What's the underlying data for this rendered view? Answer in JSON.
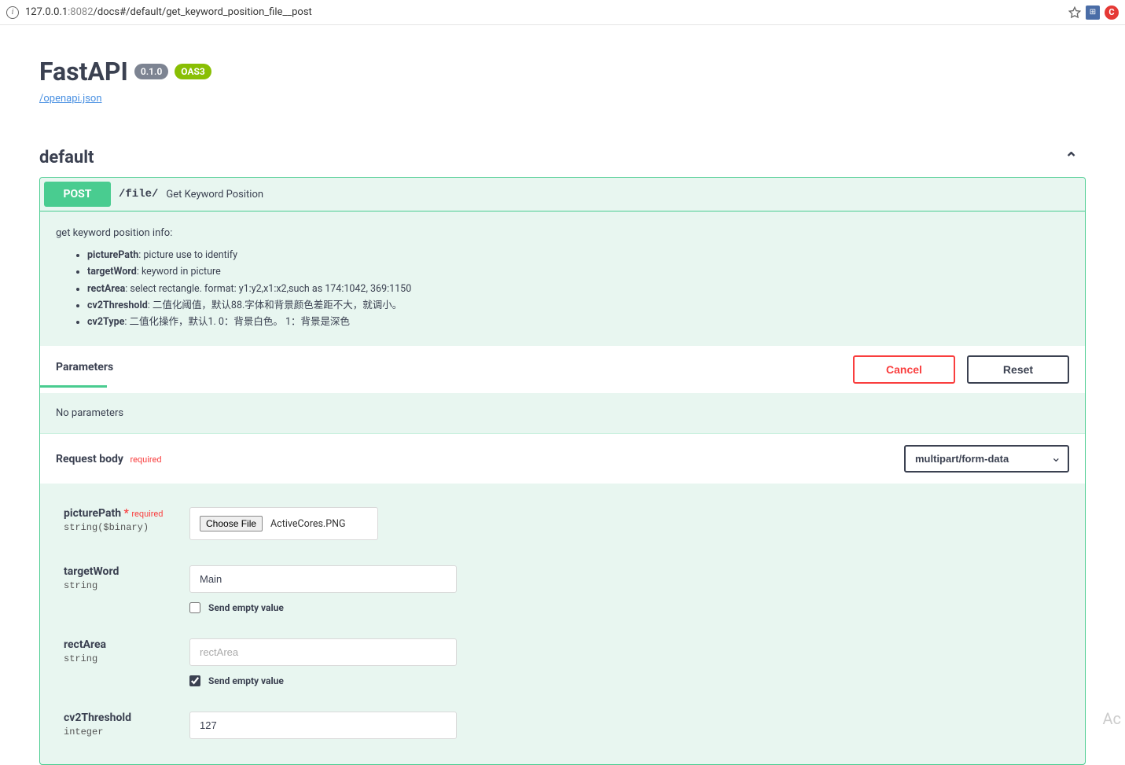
{
  "browser": {
    "url_host": "127.0.0.1",
    "url_port": ":8082",
    "url_path": "/docs#/default/get_keyword_position_file__post"
  },
  "header": {
    "title": "FastAPI",
    "version": "0.1.0",
    "oas": "OAS3",
    "openapi_link": "/openapi.json"
  },
  "section": {
    "name": "default"
  },
  "operation": {
    "method": "POST",
    "path": "/file/",
    "summary": "Get Keyword Position",
    "description": "get keyword position info:",
    "desc_items": [
      {
        "name": "picturePath",
        "text": ": picture use to identify"
      },
      {
        "name": "targetWord",
        "text": ": keyword in picture"
      },
      {
        "name": "rectArea",
        "text": ": select rectangle. format: y1:y2,x1:x2,such as 174:1042, 369:1150"
      },
      {
        "name": "cv2Threshold",
        "text": ": 二值化阈值，默认88.字体和背景颜色差距不大，就调小。"
      },
      {
        "name": "cv2Type",
        "text": ": 二值化操作，默认1. 0：背景白色。 1：背景是深色"
      }
    ]
  },
  "params": {
    "header_title": "Parameters",
    "cancel": "Cancel",
    "reset": "Reset",
    "no_params": "No parameters"
  },
  "request_body": {
    "title": "Request body",
    "required_label": "required",
    "content_type": "multipart/form-data"
  },
  "fields": {
    "picturePath": {
      "name": "picturePath",
      "required_marker": "*",
      "required_text": "required",
      "type": "string($binary)",
      "choose_file": "Choose File",
      "file_name": "ActiveCores.PNG"
    },
    "targetWord": {
      "name": "targetWord",
      "type": "string",
      "value": "Main",
      "send_empty": "Send empty value"
    },
    "rectArea": {
      "name": "rectArea",
      "type": "string",
      "placeholder": "rectArea",
      "send_empty": "Send empty value"
    },
    "cv2Threshold": {
      "name": "cv2Threshold",
      "type": "integer",
      "value": "127"
    }
  }
}
